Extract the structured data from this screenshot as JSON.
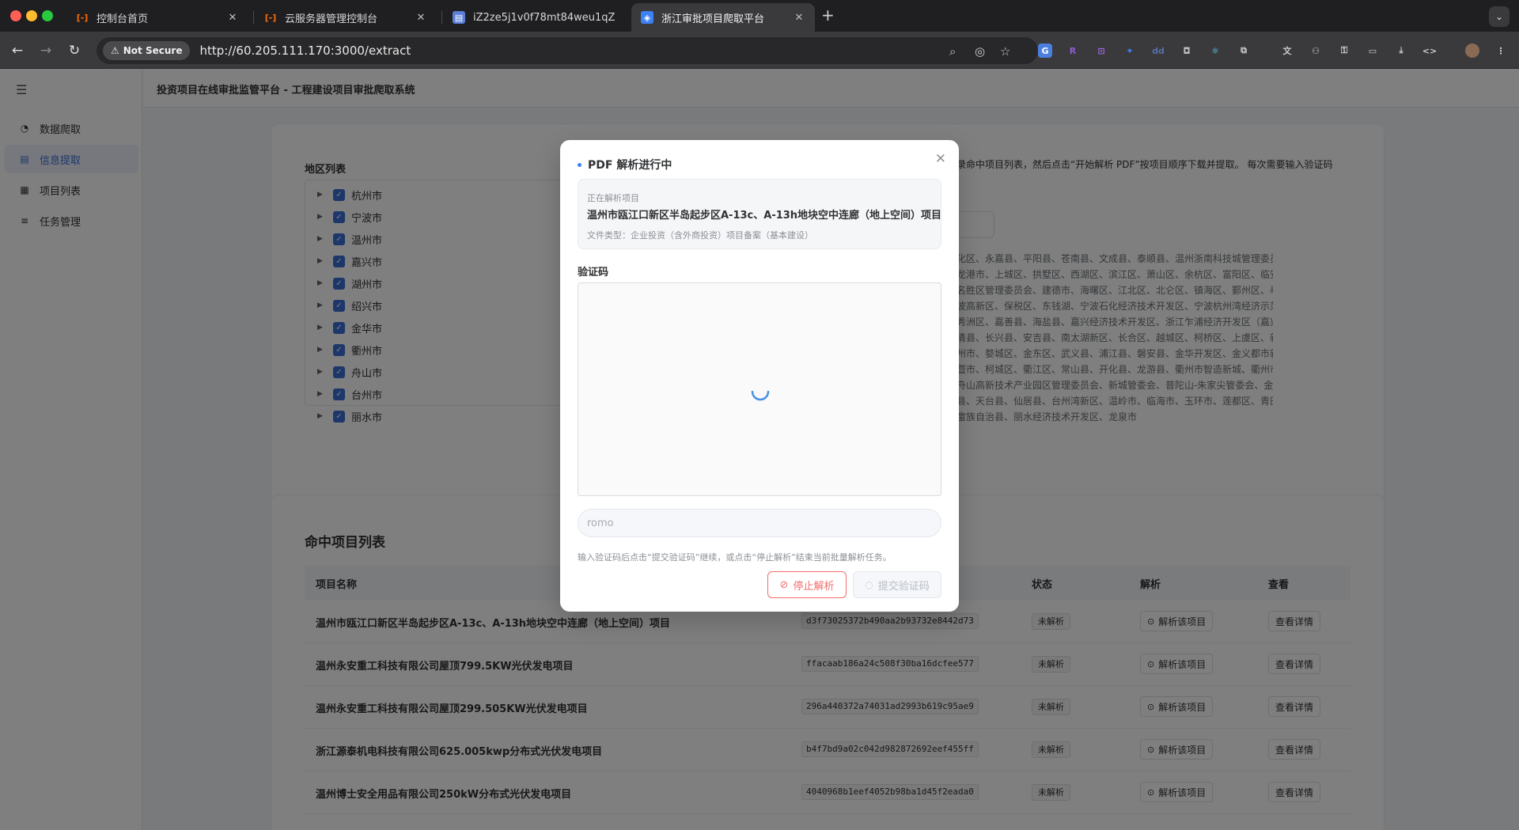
{
  "browser": {
    "tabs": [
      {
        "title": "控制台首页",
        "icon": "aliyun-icon"
      },
      {
        "title": "云服务器管理控制台",
        "icon": "aliyun-icon"
      },
      {
        "title": "iZ2ze5j1v0f78mt84weu1qZ - ",
        "icon": "server-icon"
      },
      {
        "title": "浙江审批项目爬取平台",
        "icon": "app-icon"
      }
    ],
    "not_secure": "Not Secure",
    "url": "http://60.205.111.170:3000/extract"
  },
  "sidebar": {
    "items": [
      {
        "label": "数据爬取",
        "icon": "dashboard-icon"
      },
      {
        "label": "信息提取",
        "icon": "document-icon"
      },
      {
        "label": "项目列表",
        "icon": "table-icon"
      },
      {
        "label": "任务管理",
        "icon": "list-icon"
      }
    ]
  },
  "header": {
    "title": "投资项目在线审批监管平台 - 工程建设项目审批爬取系统"
  },
  "region": {
    "title": "地区列表",
    "items": [
      "杭州市",
      "宁波市",
      "温州市",
      "嘉兴市",
      "湖州市",
      "绍兴市",
      "金华市",
      "衢州市",
      "舟山市",
      "台州市",
      "丽水市"
    ],
    "description": "录命中项目列表，然后点击“开始解析 PDF”按项目顺序下载并提取。 每次需要输入验证码",
    "area_lines": [
      "化区、永嘉县、平阳县、苍南县、文成县、泰顺县、温州浙南科技城管理委员会、生态",
      "龙港市、上城区、拱墅区、西湖区、滨江区、萧山区、余杭区、富阳区、临安区、临平",
      "名胜区管理委员会、建德市、海曙区、江北区、北仑区、镇海区、鄞州区、奉化区、象山",
      "波高新区、保税区、东钱湖、宁波石化经济技术开发区、宁波杭州湾经济示范区、余姚市、",
      "秀洲区、嘉善县、海盐县、嘉兴经济技术开发区、浙江乍浦经济开发区（嘉兴港区）、海",
      "清县、长兴县、安吉县、南太湖新区、长合区、越城区、柯桥区、上虞区、新昌县、绍兴",
      "州市、婺城区、金东区、武义县、浦江县、磐安县、金华开发区、金义都市新区、金华双",
      "暨市、柯城区、衢江区、常山县、开化县、龙游县、衢州市智造新城、衢州市智慧新城、",
      "舟山高新技术产业园区管理委员会、新城管委会、普陀山-朱家尖管委会、金塘管委会、",
      "县、天台县、仙居县、台州湾新区、温岭市、临海市、玉环市、莲都区、青田县、缙云",
      "畲族自治县、丽水经济技术开发区、龙泉市"
    ]
  },
  "table": {
    "title": "命中项目列表",
    "headers": {
      "name": "项目名称",
      "status": "状态",
      "parse": "解析",
      "view": "查看"
    },
    "rows": [
      {
        "name": "温州市瓯江口新区半岛起步区A-13c、A-13h地块空中连廊（地上空间）项目",
        "hash": "d3f73025372b490aa2b93732e8442d73",
        "status": "未解析",
        "parse": "解析该项目",
        "view": "查看详情"
      },
      {
        "name": "温州永安重工科技有限公司屋顶799.5KW光伏发电项目",
        "hash": "ffacaab186a24c508f30ba16dcfee577",
        "status": "未解析",
        "parse": "解析该项目",
        "view": "查看详情"
      },
      {
        "name": "温州永安重工科技有限公司屋顶299.505KW光伏发电项目",
        "hash": "296a440372a74031ad2993b619c95ae9",
        "status": "未解析",
        "parse": "解析该项目",
        "view": "查看详情"
      },
      {
        "name": "浙江源泰机电科技有限公司625.005kwp分布式光伏发电项目",
        "hash": "b4f7bd9a02c042d982872692eef455ff",
        "status": "未解析",
        "parse": "解析该项目",
        "view": "查看详情"
      },
      {
        "name": "温州博士安全用品有限公司250kW分布式光伏发电项目",
        "hash": "4040968b1eef4052b98ba1d45f2eada0",
        "status": "未解析",
        "parse": "解析该项目",
        "view": "查看详情"
      }
    ]
  },
  "dialog": {
    "title": "PDF 解析进行中",
    "parsing_label": "正在解析项目",
    "project_name": "温州市瓯江口新区半岛起步区A-13c、A-13h地块空中连廊（地上空间）项目",
    "file_type": "文件类型：企业投资（含外商投资）项目备案（基本建设）",
    "captcha_label": "验证码",
    "captcha_value": "romo",
    "hint": "输入验证码后点击“提交验证码”继续，或点击“停止解析”结束当前批量解析任务。",
    "stop_label": "停止解析",
    "submit_label": "提交验证码"
  },
  "colors": {
    "accent": "#3b6fd6",
    "danger": "#f56c6c",
    "overlay": "rgba(0,0,0,0.5)"
  }
}
